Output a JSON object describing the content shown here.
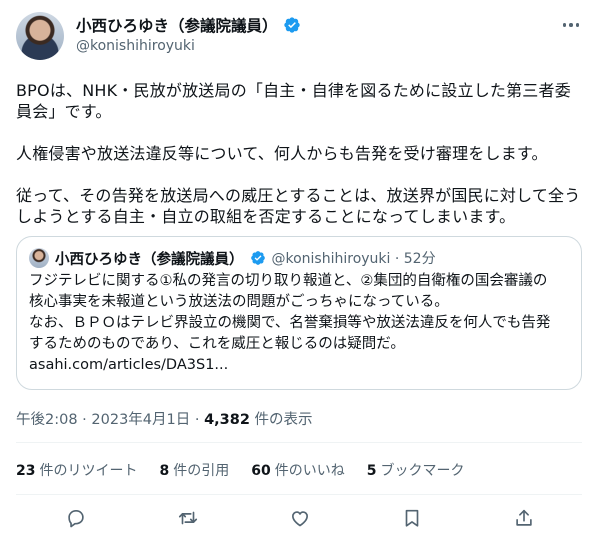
{
  "colors": {
    "accent": "#1d9bf0",
    "text": "#0f1419",
    "muted": "#536471",
    "border": "#cfd9de"
  },
  "author": {
    "display_name": "小西ひろゆき（参議院議員）",
    "handle": "@konishihiroyuki",
    "verified_icon": "verified-badge-icon"
  },
  "tweet": {
    "paragraphs": [
      "BPOは、NHK・民放が放送局の「自主・自律を図るために設立した第三者委員会」です。",
      "人権侵害や放送法違反等について、何人からも告発を受け審理をします。",
      "従って、その告発を放送局への威圧とすることは、放送界が国民に対して全うしようとする自主・自立の取組を否定することになってしまいます。"
    ],
    "timestamp": "午後2:08 · 2023年4月1日 · ",
    "views_count": "4,382",
    "views_label": " 件の表示"
  },
  "quote": {
    "display_name": "小西ひろゆき（参議院議員）",
    "handle_time": "@konishihiroyuki · 52分",
    "lines": [
      "フジテレビに関する①私の発言の切り取り報道と、②集団的自衛権の国会審議の",
      "核心事実を未報道という放送法の問題がごっちゃになっている。",
      "なお、ＢＰＯはテレビ界設立の機関で、名誉棄損等や放送法違反を何人でも告発",
      "するためのものであり、これを威圧と報じるのは疑問だ。",
      "asahi.com/articles/DA3S1..."
    ]
  },
  "stats": [
    {
      "count": "23",
      "label": "件のリツイート"
    },
    {
      "count": "8",
      "label": "件の引用"
    },
    {
      "count": "60",
      "label": "件のいいね"
    },
    {
      "count": "5",
      "label": "ブックマーク"
    }
  ],
  "actions": [
    "reply-icon",
    "retweet-icon",
    "like-icon",
    "bookmark-icon",
    "share-icon"
  ]
}
